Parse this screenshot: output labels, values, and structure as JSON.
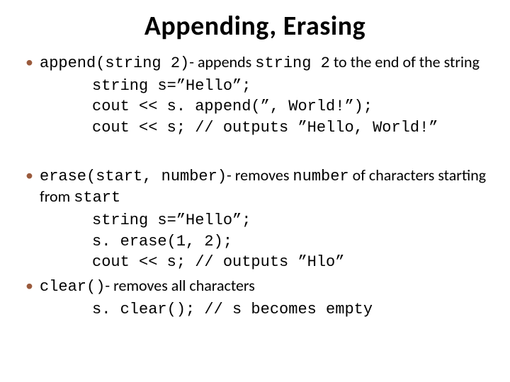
{
  "title": "Appending, Erasing",
  "bullets": {
    "b1": {
      "func": "append(string 2)",
      "desc1": "- appends ",
      "arg": "string 2",
      "desc2": "  to the end of the string"
    },
    "b1_code": "string s=”Hello”;\ncout << s. append(”, World!”);\ncout << s; // outputs ”Hello, World!”",
    "b2": {
      "func": "erase(start, number)",
      "desc1": "- removes ",
      "arg1": "number",
      "desc2": " of characters starting from ",
      "arg2": "start"
    },
    "b2_code": "string s=”Hello”;\ns. erase(1, 2);\ncout << s; // outputs ”Hlo”",
    "b3": {
      "func": "clear()",
      "desc": "- removes all characters"
    },
    "b3_code": "s. clear(); // s becomes empty"
  }
}
